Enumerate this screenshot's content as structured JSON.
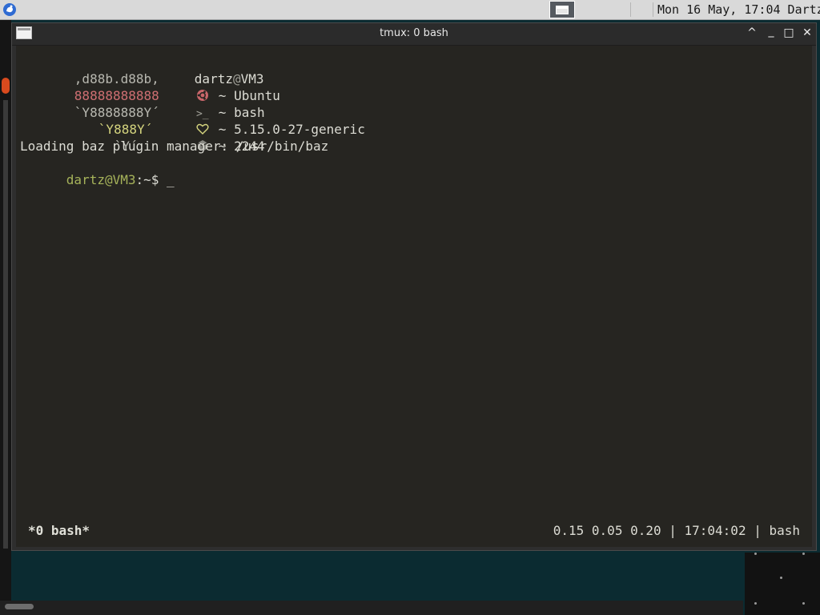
{
  "panel": {
    "clock": "Mon 16 May, 17:04 Dartz",
    "app_menu_icon": "app-menu-icon",
    "task_icon": "window-icon"
  },
  "window": {
    "title": "tmux: 0 bash",
    "controls": [
      "^",
      "_",
      "□",
      "✕"
    ]
  },
  "terminal": {
    "logo": [
      ",d88b.d88b,",
      "88888888888",
      "`Y8888888Y´",
      "`Y888Y´",
      "`Y´"
    ],
    "info": {
      "user": "dartz",
      "at": "@",
      "host": "VM3",
      "distro": "~ Ubuntu",
      "shell": "~ bash",
      "kernel": "~ 5.15.0-27-generic",
      "packages": "~ 2244"
    },
    "icons": [
      "ubuntu-icon",
      "terminal-icon",
      "heart-icon",
      "package-icon"
    ],
    "loading_line": "Loading baz plugin manager: /usr/bin/baz",
    "prompt": {
      "user_host": "dartz@VM3",
      "path": ":~$",
      "cursor": "_"
    }
  },
  "status_bar": {
    "window_label": "*0 bash*",
    "right": "0.15 0.05 0.20 | 17:04:02 | bash"
  },
  "colors": {
    "terminal_bg": "#262521",
    "logo_red": "#cf6f72",
    "logo_yellow": "#d4d47e",
    "prompt_green": "#a6b35a",
    "desktop_bg": "#0b2b31"
  }
}
